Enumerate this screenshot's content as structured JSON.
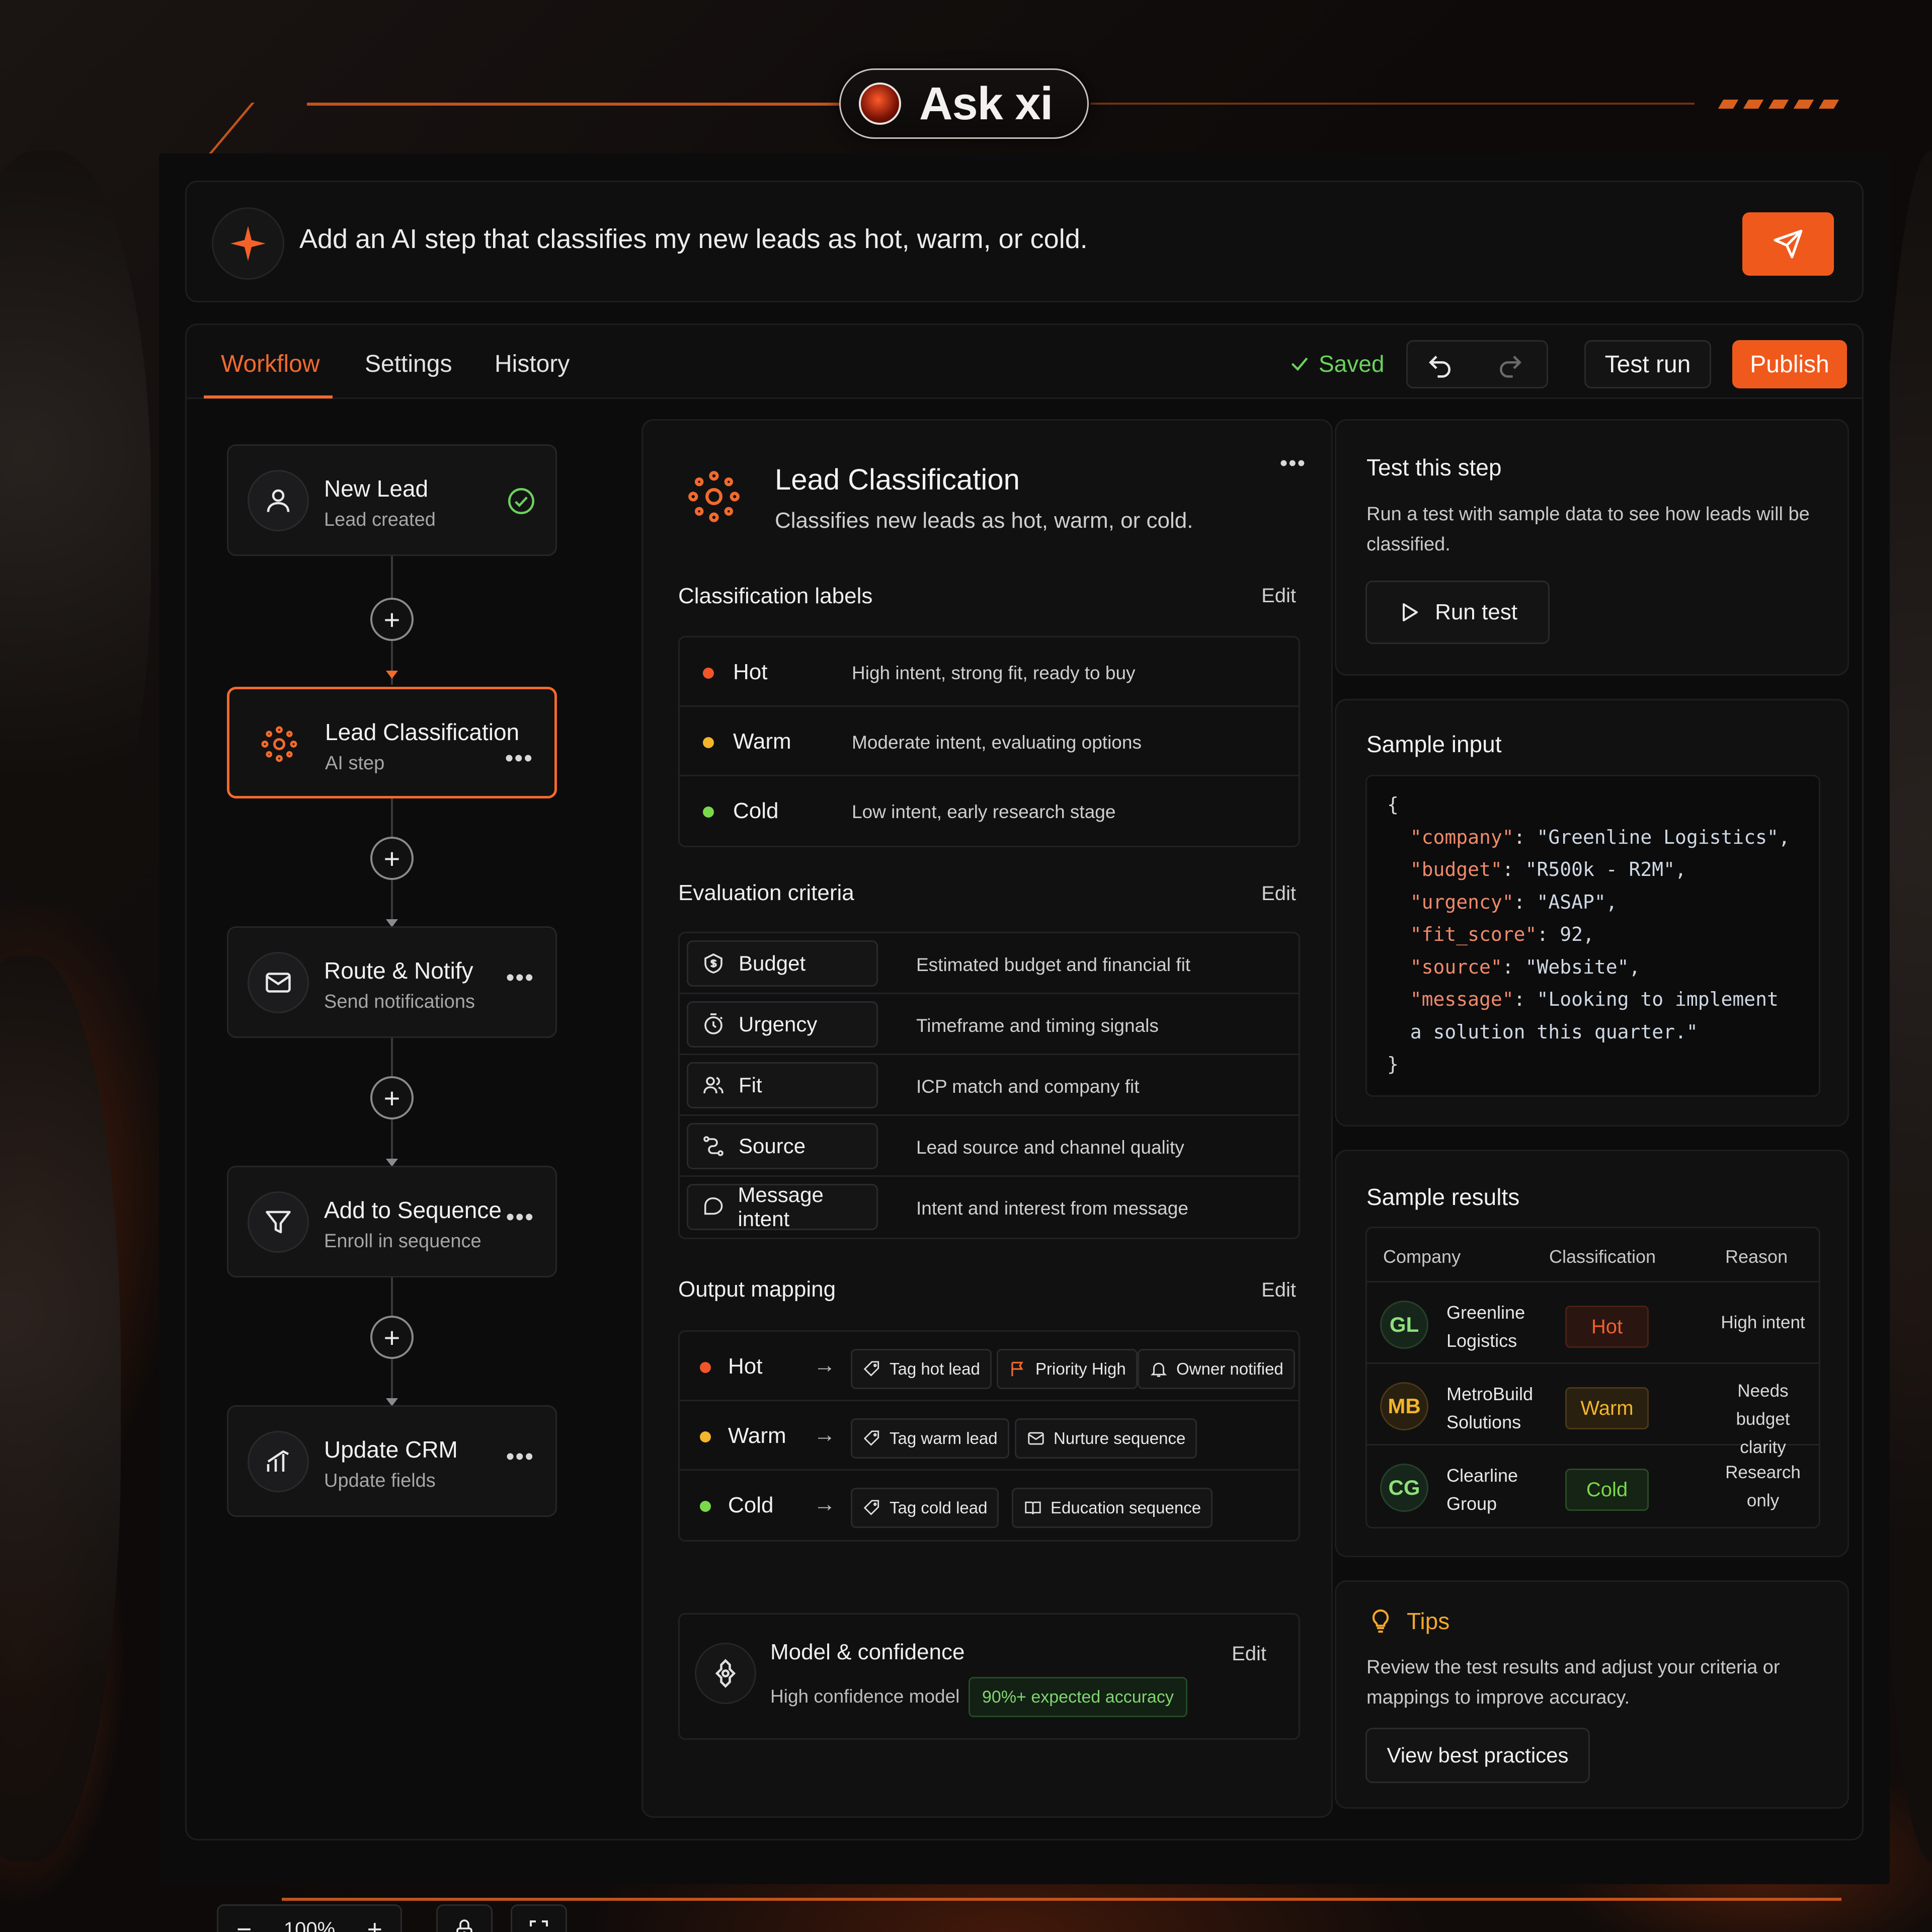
{
  "badge": {
    "title": "Ask xi"
  },
  "prompt": {
    "text": "Add an AI step that classifies my new leads as hot, warm, or cold."
  },
  "toolbar": {
    "tabs": [
      "Workflow",
      "Settings",
      "History"
    ],
    "saved": "Saved",
    "test_run": "Test run",
    "publish": "Publish"
  },
  "workflow": {
    "nodes": [
      {
        "title": "New Lead",
        "subtitle": "Lead created"
      },
      {
        "title": "Lead Classification",
        "subtitle": "AI step"
      },
      {
        "title": "Route & Notify",
        "subtitle": "Send notifications"
      },
      {
        "title": "Add to Sequence",
        "subtitle": "Enroll in sequence"
      },
      {
        "title": "Update CRM",
        "subtitle": "Update fields"
      }
    ],
    "zoom": "100%"
  },
  "config": {
    "title": "Lead Classification",
    "subtitle": "Classifies new leads as hot, warm, or cold.",
    "labels_title": "Classification labels",
    "edit": "Edit",
    "labels": [
      {
        "name": "Hot",
        "desc": "High intent, strong fit, ready to buy",
        "color": "#f0562a"
      },
      {
        "name": "Warm",
        "desc": "Moderate intent, evaluating options",
        "color": "#f2b52b"
      },
      {
        "name": "Cold",
        "desc": "Low intent, early research stage",
        "color": "#7bd84b"
      }
    ],
    "criteria_title": "Evaluation criteria",
    "criteria": [
      {
        "name": "Budget",
        "desc": "Estimated budget and financial fit",
        "icon": "budget-icon"
      },
      {
        "name": "Urgency",
        "desc": "Timeframe and timing signals",
        "icon": "timer-icon"
      },
      {
        "name": "Fit",
        "desc": "ICP match and company fit",
        "icon": "users-icon"
      },
      {
        "name": "Source",
        "desc": "Lead source and channel quality",
        "icon": "route-icon"
      },
      {
        "name": "Message intent",
        "desc": "Intent and interest from message",
        "icon": "message-icon"
      }
    ],
    "output_title": "Output mapping",
    "outputs": [
      {
        "name": "Hot",
        "tags": [
          "Tag hot lead",
          "Priority High",
          "Owner notified"
        ]
      },
      {
        "name": "Warm",
        "tags": [
          "Tag warm lead",
          "Nurture sequence"
        ]
      },
      {
        "name": "Cold",
        "tags": [
          "Tag cold lead",
          "Education sequence"
        ]
      }
    ],
    "model_title": "Model & confidence",
    "model_sub": "High confidence model",
    "model_badge": "90%+ expected accuracy"
  },
  "test_step": {
    "title": "Test this step",
    "body": "Run a test with sample data to see how leads will be classified.",
    "button": "Run test"
  },
  "sample_input": {
    "title": "Sample input",
    "open": "{",
    "close": "}",
    "lines": [
      {
        "key": "\"company\"",
        "value": "\"Greenline Logistics\","
      },
      {
        "key": "\"budget\"",
        "value": "\"R500k - R2M\","
      },
      {
        "key": "\"urgency\"",
        "value": "\"ASAP\","
      },
      {
        "key": "\"fit_score\"",
        "value": "92,"
      },
      {
        "key": "\"source\"",
        "value": "\"Website\","
      },
      {
        "key": "\"message\"",
        "value": "\"Looking to implement"
      }
    ],
    "continuation": "a solution this quarter.\""
  },
  "sample_results": {
    "title": "Sample results",
    "headers": [
      "Company",
      "Classification",
      "Reason"
    ],
    "rows": [
      {
        "initials": "GL",
        "company_1": "Greenline",
        "company_2": "Logistics",
        "class": "Hot",
        "reason_1": "High intent",
        "reason_2": ""
      },
      {
        "initials": "MB",
        "company_1": "MetroBuild",
        "company_2": "Solutions",
        "class": "Warm",
        "reason_1": "Needs budget",
        "reason_2": "clarity"
      },
      {
        "initials": "CG",
        "company_1": "Clearline",
        "company_2": "Group",
        "class": "Cold",
        "reason_1": "Research",
        "reason_2": "only"
      }
    ]
  },
  "tips": {
    "title": "Tips",
    "body": "Review the test results and adjust your criteria or mappings to improve accuracy.",
    "button": "View best practices"
  },
  "colors": {
    "accent": "#f0591c",
    "success": "#6cd25c",
    "hot": "#f0562a",
    "warm": "#f2b52b",
    "cold": "#7bd84b"
  }
}
